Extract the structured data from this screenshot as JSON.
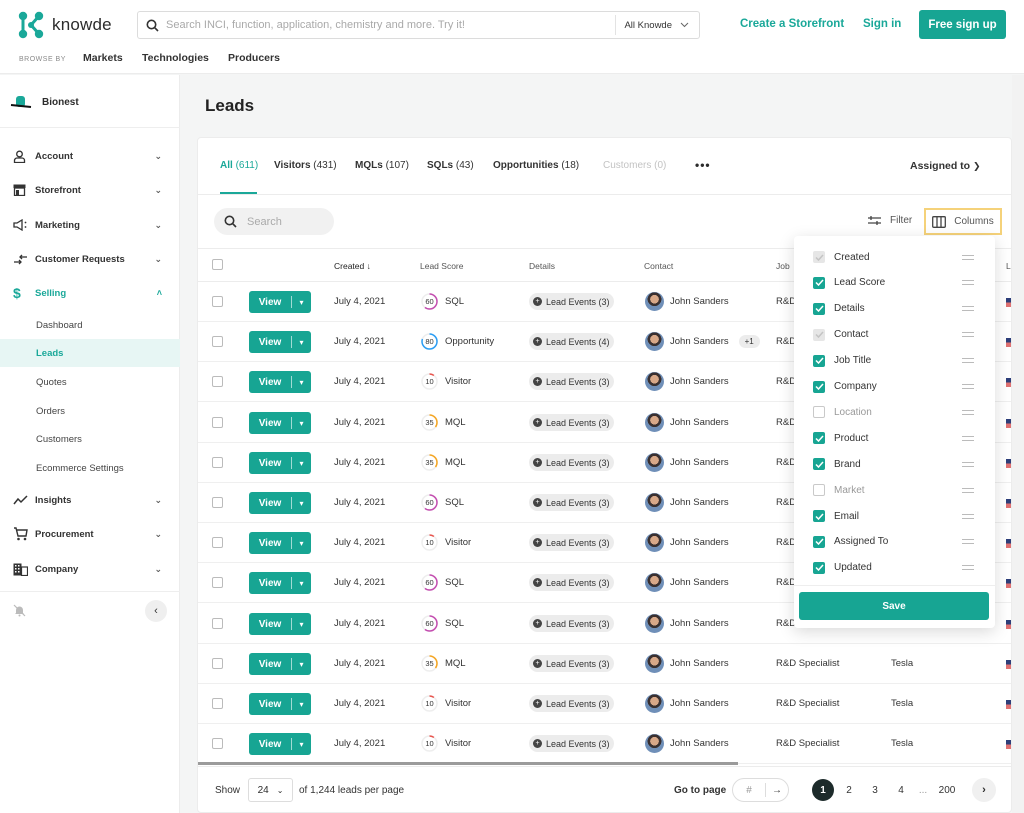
{
  "topbar": {
    "logo_text": "knowde",
    "search_placeholder": "Search INCI, function, application, chemistry and more. Try it!",
    "search_scope": "All Knowde",
    "create_storefront": "Create a Storefront",
    "sign_in": "Sign in",
    "free_signup": "Free sign up",
    "browse_by": "BROWSE BY",
    "browse_items": [
      "Markets",
      "Technologies",
      "Producers"
    ]
  },
  "sidebar": {
    "brand": "Bionest",
    "items": [
      {
        "label": "Account",
        "icon": "user-icon",
        "expanded": false
      },
      {
        "label": "Storefront",
        "icon": "store-icon",
        "expanded": false
      },
      {
        "label": "Marketing",
        "icon": "megaphone-icon",
        "expanded": false
      },
      {
        "label": "Customer Requests",
        "icon": "arrows-exchange-icon",
        "expanded": false
      },
      {
        "label": "Selling",
        "icon": "dollar-icon",
        "expanded": true,
        "active": true
      },
      {
        "label": "Insights",
        "icon": "trend-icon",
        "expanded": false
      },
      {
        "label": "Procurement",
        "icon": "cart-icon",
        "expanded": false
      },
      {
        "label": "Company",
        "icon": "building-icon",
        "expanded": false
      }
    ],
    "selling_sub": [
      "Dashboard",
      "Leads",
      "Quotes",
      "Orders",
      "Customers",
      "Ecommerce Settings"
    ],
    "active_sub": "Leads"
  },
  "page": {
    "title": "Leads",
    "tabs": [
      {
        "label": "All",
        "count": "(611)",
        "state": "active"
      },
      {
        "label": "Visitors",
        "count": "(431)",
        "state": "normal"
      },
      {
        "label": "MQLs",
        "count": "(107)",
        "state": "normal"
      },
      {
        "label": "SQLs",
        "count": "(43)",
        "state": "normal"
      },
      {
        "label": "Opportunities",
        "count": "(18)",
        "state": "normal"
      },
      {
        "label": "Customers",
        "count": "(0)",
        "state": "disabled"
      }
    ],
    "more": "•••",
    "assigned_to": "Assigned to",
    "search_placeholder": "Search",
    "filter": "Filter",
    "columns": "Columns"
  },
  "table": {
    "headers": {
      "created": "Created",
      "lead_score": "Lead Score",
      "details": "Details",
      "contact": "Contact",
      "job": "Job",
      "location": "Lo"
    },
    "view_label": "View",
    "rows": [
      {
        "created": "July 4, 2021",
        "score": 60,
        "stage": "SQL",
        "color": "#c44db0",
        "events": "Lead Events (3)",
        "contact": "John Sanders",
        "extra": "",
        "job": "R&D",
        "company": ""
      },
      {
        "created": "July 4, 2021",
        "score": 80,
        "stage": "Opportunity",
        "color": "#2a9df4",
        "events": "Lead Events (4)",
        "contact": "John Sanders",
        "extra": "+1",
        "job": "R&D",
        "company": ""
      },
      {
        "created": "July 4, 2021",
        "score": 10,
        "stage": "Visitor",
        "color": "#e8554e",
        "events": "Lead Events (3)",
        "contact": "John Sanders",
        "extra": "",
        "job": "R&D",
        "company": ""
      },
      {
        "created": "July 4, 2021",
        "score": 35,
        "stage": "MQL",
        "color": "#f5a623",
        "events": "Lead Events (3)",
        "contact": "John Sanders",
        "extra": "",
        "job": "R&D",
        "company": ""
      },
      {
        "created": "July 4, 2021",
        "score": 35,
        "stage": "MQL",
        "color": "#f5a623",
        "events": "Lead Events (3)",
        "contact": "John Sanders",
        "extra": "",
        "job": "R&D",
        "company": ""
      },
      {
        "created": "July 4, 2021",
        "score": 60,
        "stage": "SQL",
        "color": "#c44db0",
        "events": "Lead Events (3)",
        "contact": "John Sanders",
        "extra": "",
        "job": "R&D",
        "company": ""
      },
      {
        "created": "July 4, 2021",
        "score": 10,
        "stage": "Visitor",
        "color": "#e8554e",
        "events": "Lead Events (3)",
        "contact": "John Sanders",
        "extra": "",
        "job": "R&D",
        "company": ""
      },
      {
        "created": "July 4, 2021",
        "score": 60,
        "stage": "SQL",
        "color": "#c44db0",
        "events": "Lead Events (3)",
        "contact": "John Sanders",
        "extra": "",
        "job": "R&D",
        "company": ""
      },
      {
        "created": "July 4, 2021",
        "score": 60,
        "stage": "SQL",
        "color": "#c44db0",
        "events": "Lead Events (3)",
        "contact": "John Sanders",
        "extra": "",
        "job": "R&D",
        "company": ""
      },
      {
        "created": "July 4, 2021",
        "score": 35,
        "stage": "MQL",
        "color": "#f5a623",
        "events": "Lead Events (3)",
        "contact": "John Sanders",
        "extra": "",
        "job": "R&D Specialist",
        "company": "Tesla"
      },
      {
        "created": "July 4, 2021",
        "score": 10,
        "stage": "Visitor",
        "color": "#e8554e",
        "events": "Lead Events (3)",
        "contact": "John Sanders",
        "extra": "",
        "job": "R&D Specialist",
        "company": "Tesla"
      },
      {
        "created": "July 4, 2021",
        "score": 10,
        "stage": "Visitor",
        "color": "#e8554e",
        "events": "Lead Events (3)",
        "contact": "John Sanders",
        "extra": "",
        "job": "R&D Specialist",
        "company": "Tesla"
      }
    ]
  },
  "columns_popover": {
    "items": [
      {
        "label": "Created",
        "state": "locked"
      },
      {
        "label": "Lead Score",
        "state": "on"
      },
      {
        "label": "Details",
        "state": "on"
      },
      {
        "label": "Contact",
        "state": "locked"
      },
      {
        "label": "Job Title",
        "state": "on"
      },
      {
        "label": "Company",
        "state": "on"
      },
      {
        "label": "Location",
        "state": "off"
      },
      {
        "label": "Product",
        "state": "on"
      },
      {
        "label": "Brand",
        "state": "on"
      },
      {
        "label": "Market",
        "state": "off"
      },
      {
        "label": "Email",
        "state": "on"
      },
      {
        "label": "Assigned To",
        "state": "on"
      },
      {
        "label": "Updated",
        "state": "on"
      }
    ],
    "save": "Save"
  },
  "footer": {
    "show": "Show",
    "per_page": "24",
    "of_leads": "of 1,244 leads per page",
    "go_to_page": "Go to page",
    "page_input_placeholder": "#",
    "pages": [
      "1",
      "2",
      "3",
      "4",
      "...",
      "200"
    ],
    "current_page": "1"
  },
  "colors": {
    "accent": "#17a593",
    "highlight": "#f5d27a"
  }
}
